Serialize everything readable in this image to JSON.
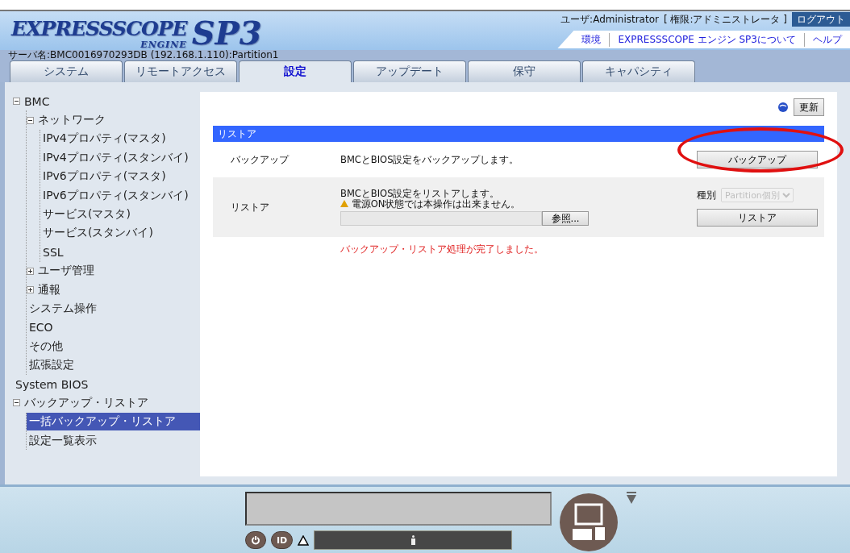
{
  "logo": {
    "main": "EXPRESSSCOPE",
    "sub": "ENGINE",
    "version": "SP3"
  },
  "server_name": "サーバ名:BMC0016970293DB (192.168.1.110):Partition1",
  "user": {
    "label": "ユーザ:Administrator",
    "role": "[ 権限:アドミニストレータ ]",
    "logout": "ログアウト"
  },
  "links": [
    "環境",
    "EXPRESSSCOPE エンジン SP3について",
    "ヘルプ"
  ],
  "tabs": [
    {
      "label": "システム",
      "selected": false
    },
    {
      "label": "リモートアクセス",
      "selected": false
    },
    {
      "label": "設定",
      "selected": true
    },
    {
      "label": "アップデート",
      "selected": false
    },
    {
      "label": "保守",
      "selected": false
    },
    {
      "label": "キャパシティ",
      "selected": false
    }
  ],
  "tree": [
    {
      "label": "BMC",
      "expanded": true,
      "selected": false,
      "children": [
        {
          "label": "ネットワーク",
          "expanded": true,
          "selected": false,
          "children": [
            {
              "label": "IPv4プロパティ(マスタ)",
              "selected": false
            },
            {
              "label": "IPv4プロパティ(スタンバイ)",
              "selected": false
            },
            {
              "label": "IPv6プロパティ(マスタ)",
              "selected": false
            },
            {
              "label": "IPv6プロパティ(スタンバイ)",
              "selected": false
            },
            {
              "label": "サービス(マスタ)",
              "selected": false
            },
            {
              "label": "サービス(スタンバイ)",
              "selected": false
            },
            {
              "label": "SSL",
              "selected": false
            }
          ]
        },
        {
          "label": "ユーザ管理",
          "expanded": false,
          "selected": false
        },
        {
          "label": "通報",
          "expanded": false,
          "selected": false
        },
        {
          "label": "システム操作",
          "selected": false
        },
        {
          "label": "ECO",
          "selected": false
        },
        {
          "label": "その他",
          "selected": false
        },
        {
          "label": "拡張設定",
          "selected": false
        }
      ]
    },
    {
      "label": "System BIOS",
      "selected": false
    },
    {
      "label": "バックアップ・リストア",
      "expanded": true,
      "selected": false,
      "children": [
        {
          "label": "一括バックアップ・リストア",
          "selected": true
        },
        {
          "label": "設定一覧表示",
          "selected": false
        }
      ]
    }
  ],
  "refresh_button": "更新",
  "section_title": "リストア",
  "backup": {
    "label": "バックアップ",
    "description": "BMCとBIOS設定をバックアップします。",
    "button": "バックアップ"
  },
  "restore": {
    "label": "リストア",
    "description": "BMCとBIOS設定をリストアします。",
    "warning": "電源ON状態では本操作は出来ません。",
    "browse_button": "参照...",
    "type_label": "種別",
    "type_value": "Partition個別",
    "type_disabled": true,
    "button": "リストア"
  },
  "message": "バックアップ・リストア処理が完了しました。",
  "panel": {
    "id_button": "ID"
  }
}
